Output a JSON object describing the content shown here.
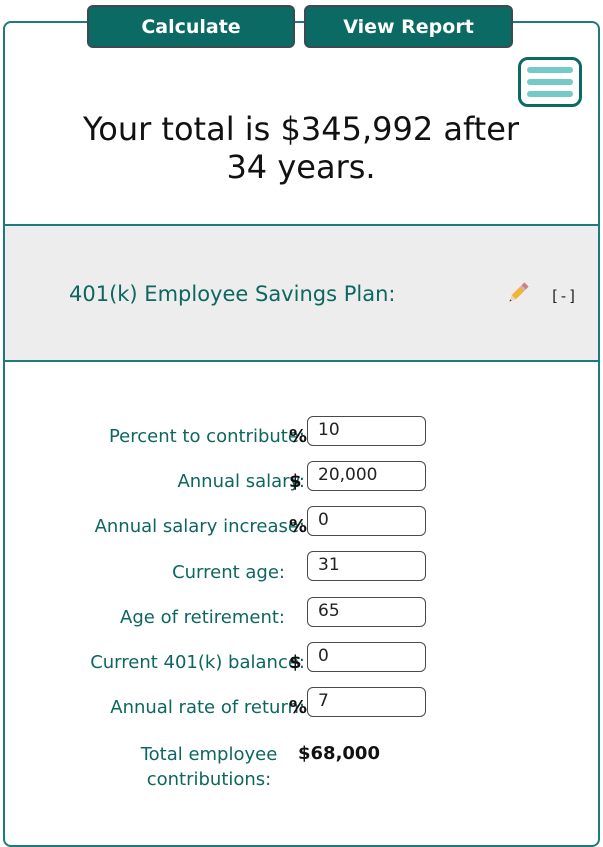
{
  "toolbar": {
    "calculate_label": "Calculate",
    "view_report_label": "View Report"
  },
  "menu": {
    "icon": "hamburger-menu-icon"
  },
  "summary": {
    "line1": "Your total is $345,992 after",
    "line2": "34 years."
  },
  "section": {
    "title": "401(k) Employee Savings Plan:",
    "edit_icon": "pencil-icon",
    "collapse_label": "[-]"
  },
  "form": {
    "fields": [
      {
        "label": "Percent to contribute:",
        "unit": "%",
        "value": "10"
      },
      {
        "label": "Annual salary:",
        "unit": "$",
        "value": "20,000"
      },
      {
        "label": "Annual salary increase:",
        "unit": "%",
        "value": "0"
      },
      {
        "label": "Current age:",
        "unit": "",
        "value": "31"
      },
      {
        "label": "Age of retirement:",
        "unit": "",
        "value": "65"
      },
      {
        "label": "Current 401(k) balance:",
        "unit": "$",
        "value": "0"
      },
      {
        "label": "Annual rate of return:",
        "unit": "%",
        "value": "7"
      }
    ],
    "total_label_line1": "Total employee",
    "total_label_line2": "contributions:",
    "total_value": "$68,000"
  },
  "colors": {
    "primary": "#0c6a64",
    "text_teal": "#0d6660",
    "menu_bars": "#74c9c9",
    "section_bg": "#ededed"
  }
}
